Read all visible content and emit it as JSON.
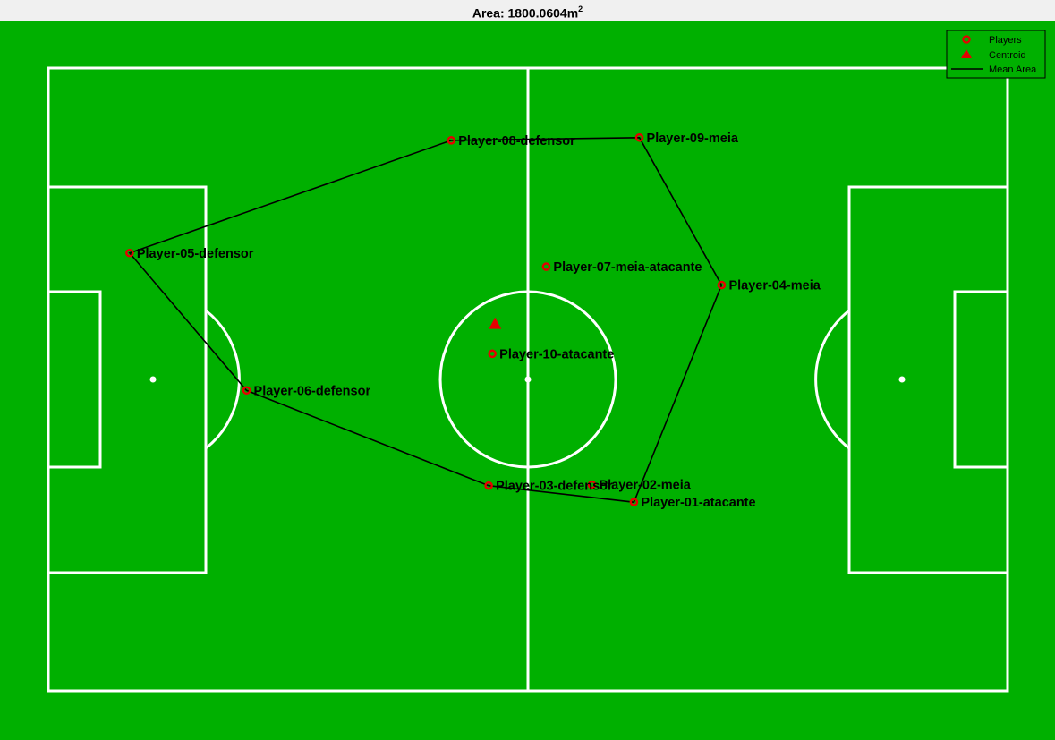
{
  "title": {
    "prefix": "Area: ",
    "value": "1800.0604",
    "unit": "m",
    "superscript": "2"
  },
  "colors": {
    "pitch": "#00b000",
    "lines": "#ffffff",
    "players": "#e60000",
    "centroid": "#e60000",
    "area_line": "#000000",
    "title_bar": "#f0f0f0"
  },
  "chart_data": {
    "type": "scatter",
    "title": "Area: 1800.0604m²",
    "xlim": [
      0,
      105
    ],
    "ylim": [
      0,
      68
    ],
    "grid": false,
    "legend_position": "top-right",
    "legend": [
      {
        "label": "Players",
        "marker": "circle"
      },
      {
        "label": "Centroid",
        "marker": "triangle"
      },
      {
        "label": "Mean Area",
        "marker": "line"
      }
    ],
    "players": [
      {
        "name": "Player-01-atacante",
        "x": 64.1,
        "y": 20.6
      },
      {
        "name": "Player-02-meia",
        "x": 59.5,
        "y": 22.5
      },
      {
        "name": "Player-03-defensor",
        "x": 48.2,
        "y": 22.4
      },
      {
        "name": "Player-04-meia",
        "x": 73.7,
        "y": 44.3
      },
      {
        "name": "Player-05-defensor",
        "x": 8.9,
        "y": 47.8
      },
      {
        "name": "Player-06-defensor",
        "x": 21.7,
        "y": 32.8
      },
      {
        "name": "Player-07-meia-atacante",
        "x": 54.5,
        "y": 46.3
      },
      {
        "name": "Player-08-defensor",
        "x": 44.1,
        "y": 60.1
      },
      {
        "name": "Player-09-meia",
        "x": 64.7,
        "y": 60.4
      },
      {
        "name": "Player-10-atacante",
        "x": 48.6,
        "y": 36.8
      }
    ],
    "centroid": {
      "x": 48.9,
      "y": 40.1
    },
    "hull_order": [
      "Player-05-defensor",
      "Player-08-defensor",
      "Player-09-meia",
      "Player-04-meia",
      "Player-01-atacante",
      "Player-03-defensor",
      "Player-06-defensor"
    ]
  }
}
